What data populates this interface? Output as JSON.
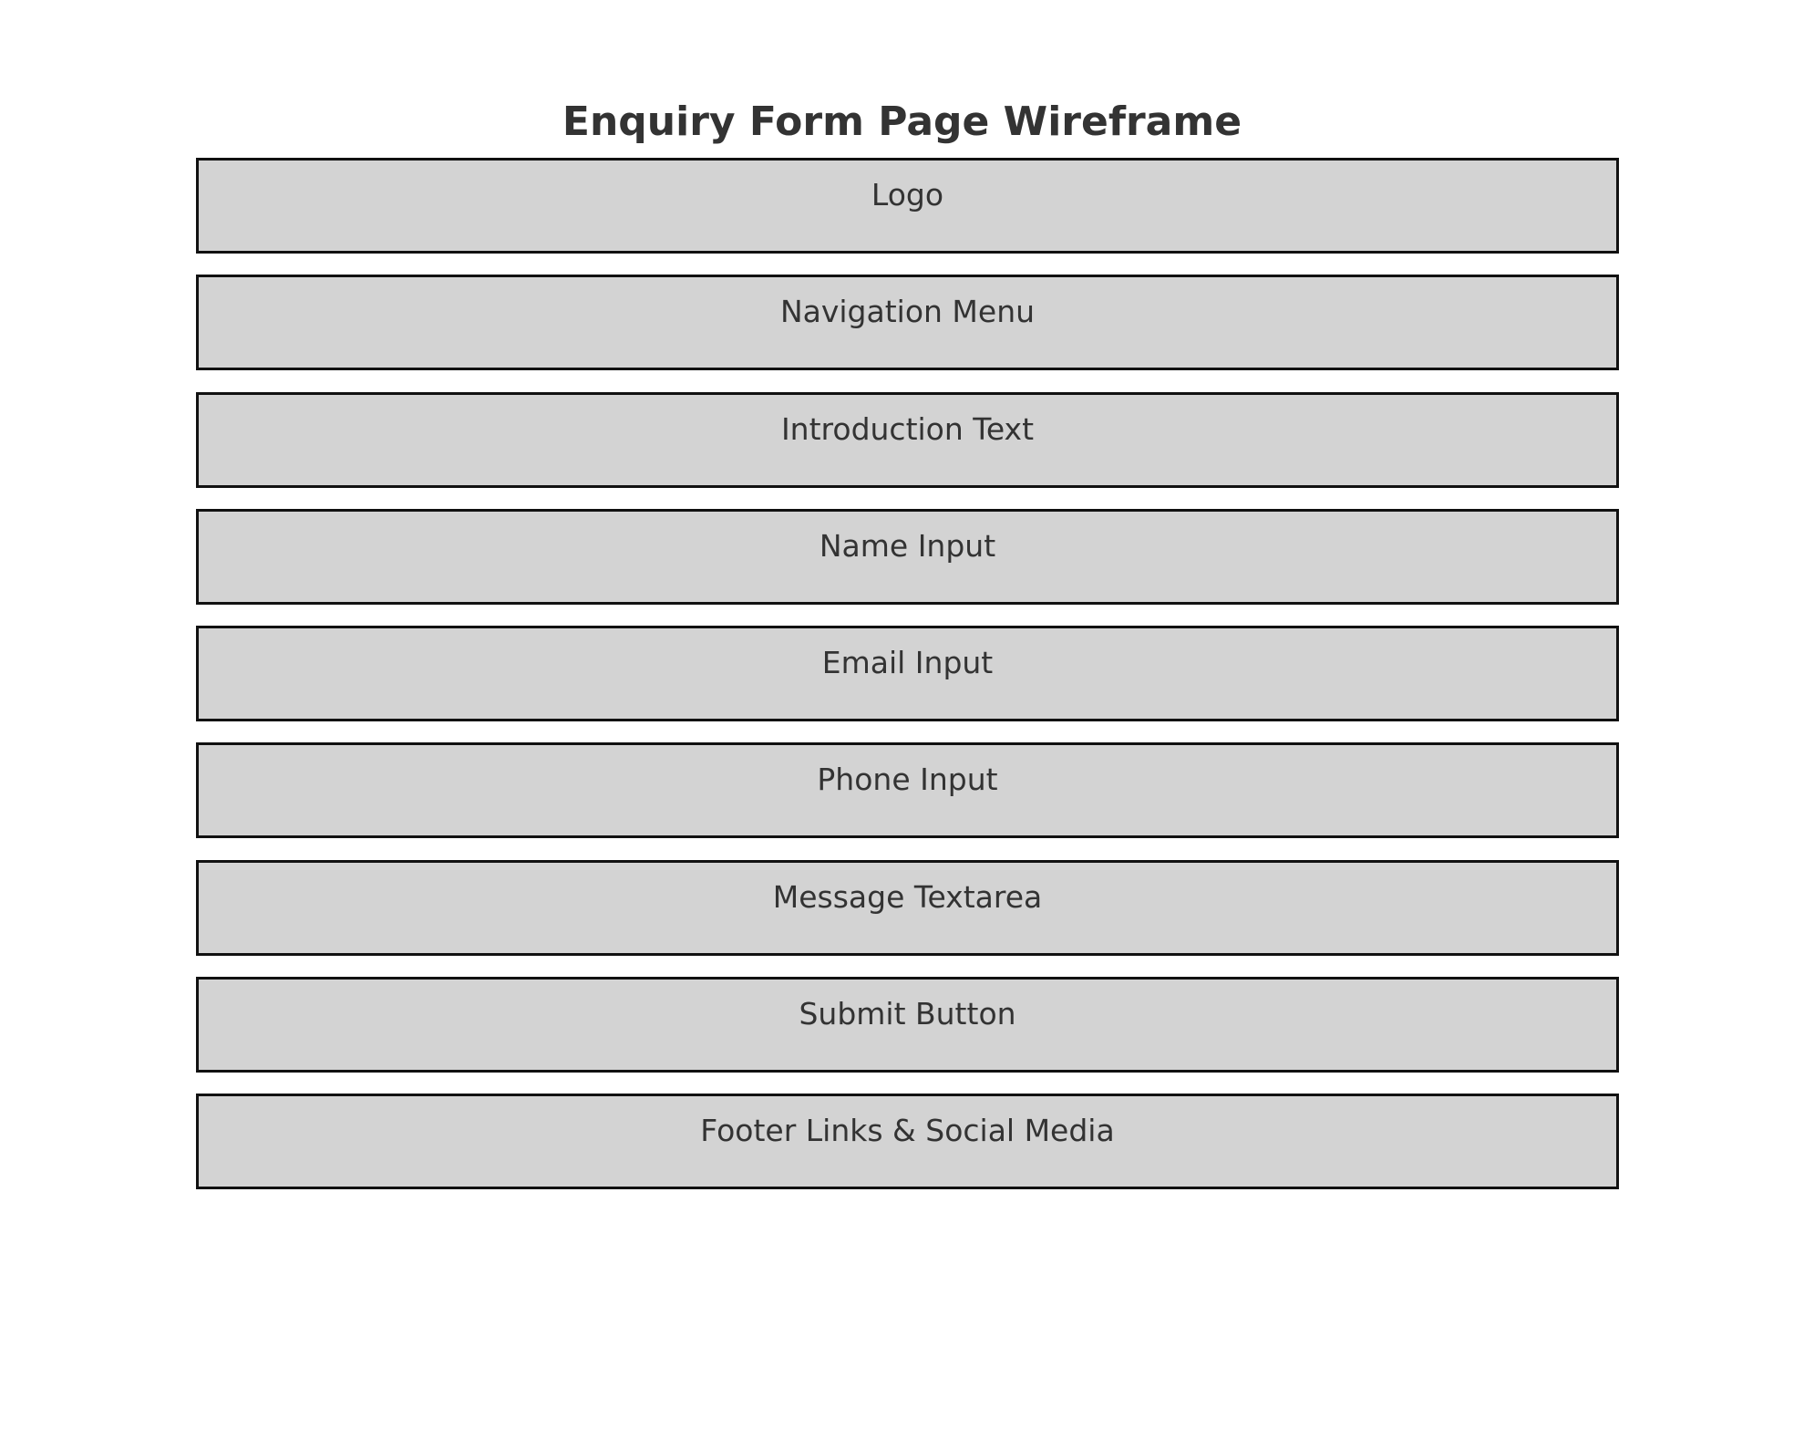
{
  "title": "Enquiry Form Page Wireframe",
  "sections": [
    {
      "label": "Logo"
    },
    {
      "label": "Navigation Menu"
    },
    {
      "label": "Introduction Text"
    },
    {
      "label": "Name Input"
    },
    {
      "label": "Email Input"
    },
    {
      "label": "Phone Input"
    },
    {
      "label": "Message Textarea"
    },
    {
      "label": "Submit Button"
    },
    {
      "label": "Footer Links & Social Media"
    }
  ],
  "colors": {
    "block_fill": "#d3d3d3",
    "block_border": "#111111",
    "text": "#333333"
  }
}
